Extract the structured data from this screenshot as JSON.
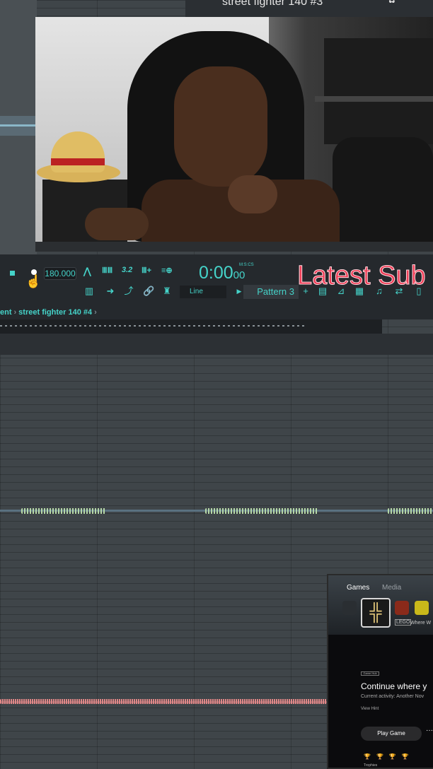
{
  "stream": {
    "title": "street fighter 140 #3",
    "logo_glyph": "✿"
  },
  "toolbar": {
    "tempo": "180.000",
    "time_main": "0:00",
    "time_small": "00",
    "time_unit": "M:S:CS",
    "overlay_text": "Latest Sub",
    "snap_mode": "Line",
    "pattern": "Pattern 3",
    "pattern_add": "+",
    "icons_row1": [
      "metronome-icon",
      "wait-icon",
      "countdown-icon",
      "step-edit-icon",
      "blend-icon"
    ],
    "icons_row1_glyphs": [
      "⋀",
      "ⅢⅢ",
      "3.2",
      "Ⅲ+",
      "≡⊕"
    ],
    "icons_row2_glyphs": [
      "▥",
      "➜",
      "⤴",
      "🔗",
      "♜",
      "∩"
    ],
    "icons_row3_glyphs": [
      "▤",
      "⊿",
      "▦",
      "♫",
      "⇄",
      "▯"
    ]
  },
  "breadcrumb": {
    "items": [
      "ent",
      "street fighter 140 #4"
    ],
    "separator": "›"
  },
  "console_panel": {
    "tab_games": "Games",
    "tab_media": "Media",
    "selected_glyph": "╬",
    "tile_label": "Where W",
    "tile_badge": "LEGO",
    "section_badge": "Game Hub",
    "continue_title": "Continue where y",
    "activity": "Current activity: Another Nov",
    "hint": "View Hint",
    "play_button": "Play Game",
    "more": "···",
    "trophies": "🏆🏆🏆🏆",
    "trophy_label": "Trophies"
  },
  "colors": {
    "accent": "#45d3c9",
    "overlay_red": "#ee3c55",
    "wave_green": "#b6d8a8",
    "wave_red": "#e08888"
  }
}
